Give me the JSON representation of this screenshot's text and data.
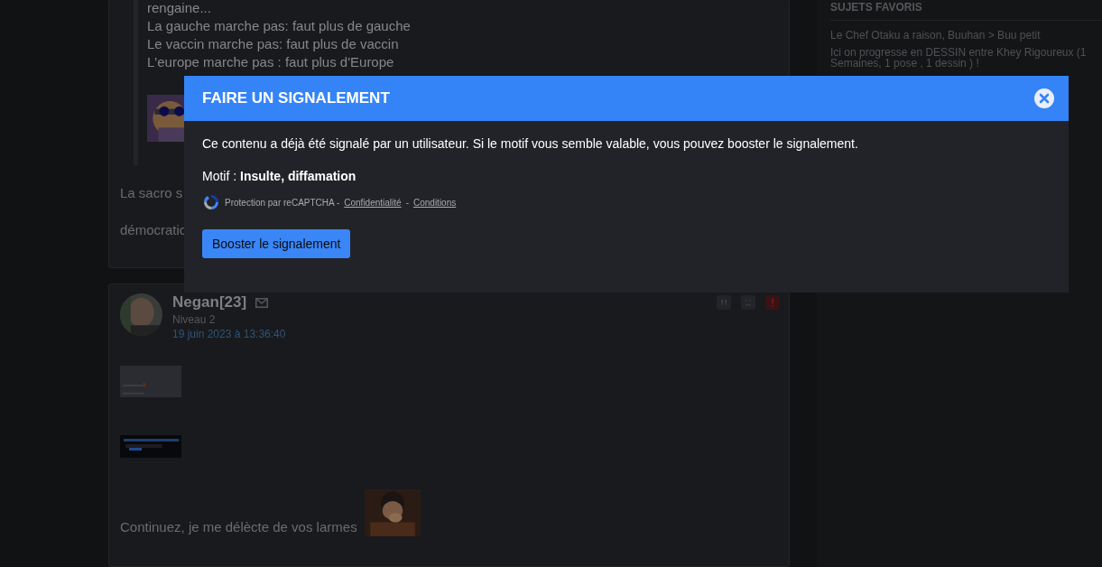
{
  "posts": [
    {
      "quote_lines": [
        "rengaine...",
        "La gauche marche pas: faut plus de gauche",
        "Le vaccin marche pas: faut plus de vaccin",
        "L'europe marche pas : faut plus d'Europe"
      ],
      "paragraphs": [
        "La sacro s",
        "démocratic"
      ]
    },
    {
      "author": "Negan[23]",
      "level": "Niveau 2",
      "date": "19 juin 2023 à 13:36:40",
      "text": "Continuez, je me délècte de vos larmes"
    }
  ],
  "sidebar": {
    "title": "SUJETS FAVORIS",
    "items": [
      "Le Chef Otaku a raison, Buuhan > Buu petit",
      "Ici on progresse en DESSIN entre Khey Rigoureux (1 Semaines, 1 pose , 1 dessin ) !"
    ]
  },
  "modal": {
    "title": "FAIRE UN SIGNALEMENT",
    "message": "Ce contenu a déjà été signalé par un utilisateur. Si le motif vous semble valable, vous pouvez booster le signalement.",
    "reason": "Motif : **Insulte, diffamation**",
    "recaptcha": {
      "text": "Protection par reCAPTCHA -",
      "links": [
        "Confidentialité",
        "Conditions"
      ],
      "separator": "-"
    },
    "button": "Booster le signalement"
  }
}
